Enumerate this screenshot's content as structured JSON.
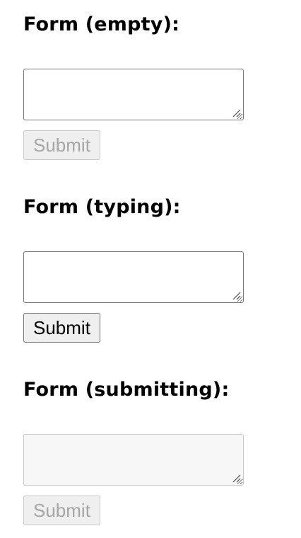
{
  "forms": [
    {
      "heading": "Form (empty):",
      "textarea_value": "",
      "textarea_disabled": false,
      "submit_label": "Submit",
      "submit_disabled": true
    },
    {
      "heading": "Form (typing):",
      "textarea_value": "",
      "textarea_disabled": false,
      "submit_label": "Submit",
      "submit_disabled": false
    },
    {
      "heading": "Form (submitting):",
      "textarea_value": "",
      "textarea_disabled": true,
      "submit_label": "Submit",
      "submit_disabled": true
    }
  ],
  "icons": {
    "resize_grip": "resize-grip-icon"
  },
  "colors": {
    "border": "#767676",
    "disabled_border": "#c8c8c8",
    "disabled_text": "#a6a6a6",
    "button_bg": "#efefef"
  }
}
